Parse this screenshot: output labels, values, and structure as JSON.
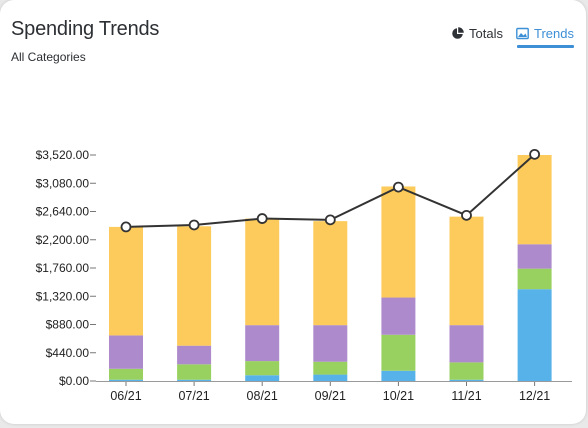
{
  "header": {
    "title": "Spending Trends",
    "subtitle": "All Categories"
  },
  "tabs": [
    {
      "label": "Totals",
      "icon": "pie-chart-icon",
      "active": false
    },
    {
      "label": "Trends",
      "icon": "image-chart-icon",
      "active": true
    }
  ],
  "colors": {
    "accent": "#3d8fd6",
    "blue": "#58b2ea",
    "green": "#99d160",
    "purple": "#ad8acb",
    "yellow": "#fdcb5b",
    "line": "#333333"
  },
  "chart_data": {
    "type": "bar",
    "stacked": true,
    "categories": [
      "06/21",
      "07/21",
      "08/21",
      "09/21",
      "10/21",
      "11/21",
      "12/21"
    ],
    "series": [
      {
        "color": "#58b2ea",
        "values": [
          20,
          20,
          90,
          100,
          160,
          20,
          1430
        ]
      },
      {
        "color": "#99d160",
        "values": [
          170,
          240,
          220,
          200,
          560,
          270,
          320
        ]
      },
      {
        "color": "#ad8acb",
        "values": [
          520,
          290,
          560,
          570,
          580,
          580,
          380
        ]
      },
      {
        "color": "#fdcb5b",
        "values": [
          1690,
          1860,
          1660,
          1620,
          1730,
          1690,
          1390
        ]
      }
    ],
    "line": {
      "values": [
        2400,
        2430,
        2530,
        2510,
        3020,
        2580,
        3530
      ]
    },
    "yticks": [
      "$0.00",
      "$440.00",
      "$880.00",
      "$1,320.00",
      "$1,760.00",
      "$2,200.00",
      "$2,640.00",
      "$3,080.00",
      "$3,520.00"
    ],
    "ylim": [
      0,
      3520
    ],
    "ytick_step": 440,
    "xlabel": "",
    "ylabel": "",
    "legend": "none",
    "grid": false
  }
}
